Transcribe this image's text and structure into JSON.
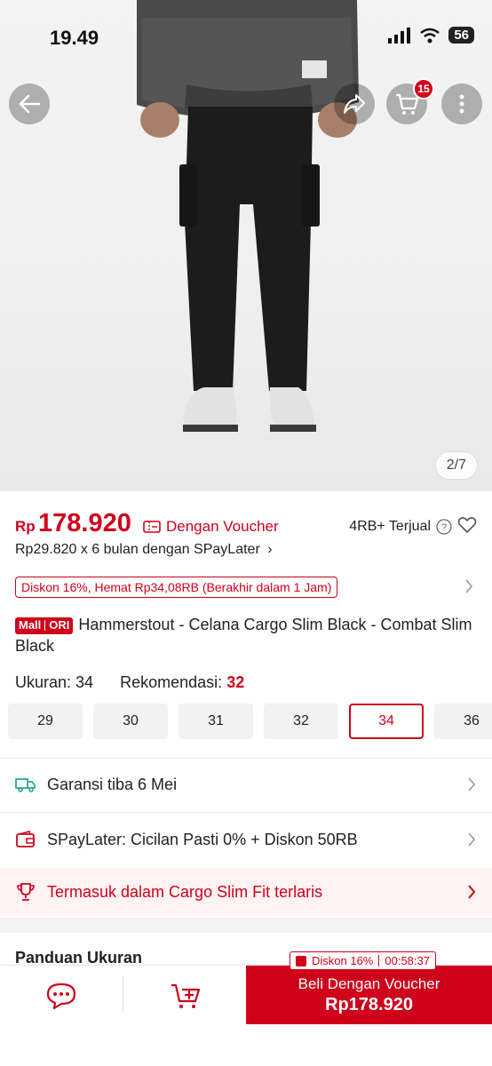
{
  "status_bar": {
    "time": "19.49",
    "battery": "56"
  },
  "hero": {
    "image_counter": "2/7",
    "cart_count": "15",
    "icons": {
      "back": "arrow-left-icon",
      "share": "share-icon",
      "cart": "cart-icon",
      "more": "more-vertical-icon"
    }
  },
  "price": {
    "currency": "Rp",
    "value": "178.920",
    "voucher_label": "Dengan Voucher",
    "sold": "4RB+ Terjual",
    "spaylater": "Rp29.820 x 6 bulan dengan SPayLater"
  },
  "discount": {
    "text": "Diskon 16%, Hemat Rp34,08RB (Berakhir dalam 1 Jam)"
  },
  "product": {
    "badge_mall": "Mall",
    "badge_ori": "ORI",
    "title": "Hammerstout - Celana Cargo Slim Black - Combat Slim Black"
  },
  "size": {
    "label": "Ukuran:",
    "selected": "34",
    "rec_label": "Rekomendasi:",
    "rec_value": "32",
    "options": [
      "29",
      "30",
      "31",
      "32",
      "34",
      "36"
    ]
  },
  "info_rows": {
    "shipping": "Garansi tiba 6 Mei",
    "spaylater": "SPayLater: Cicilan Pasti 0% + Diskon 50RB",
    "ranking": "Termasuk dalam Cargo Slim Fit terlaris"
  },
  "guide": {
    "label": "Panduan Ukuran"
  },
  "bottom_bar": {
    "promo_label": "Diskon 16%",
    "promo_time": "00:58:37",
    "buy_label": "Beli Dengan Voucher",
    "buy_price": "Rp178.920"
  },
  "colors": {
    "accent": "#d0011b",
    "teal": "#26aa99"
  }
}
